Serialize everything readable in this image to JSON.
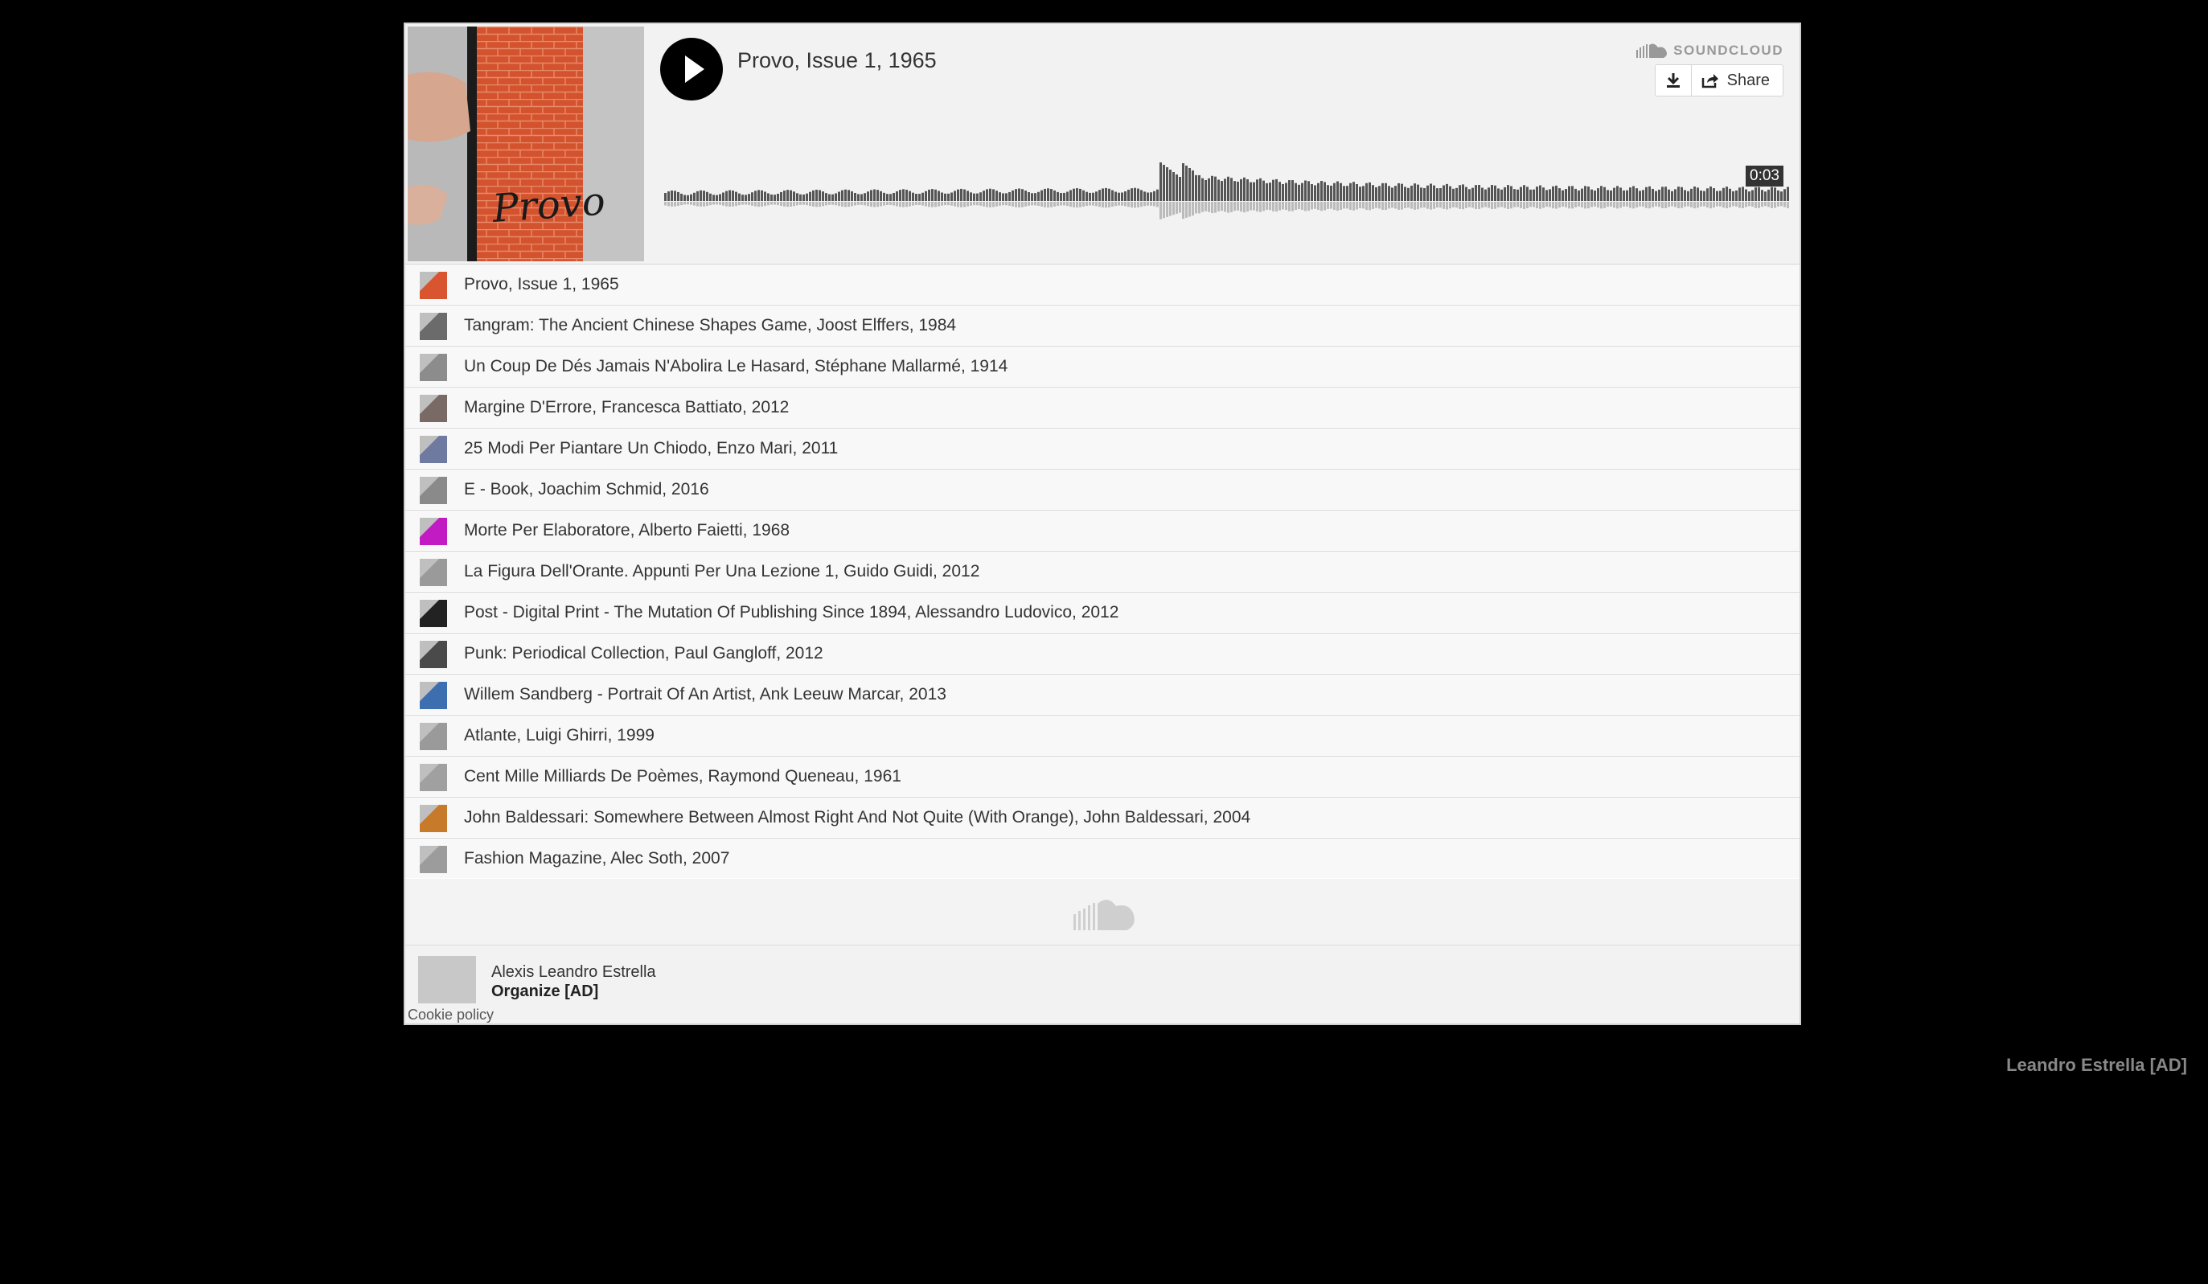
{
  "player": {
    "title": "Provo, Issue 1, 1965",
    "brand": "SOUNDCLOUD",
    "share_label": "Share",
    "time": "0:03",
    "artwork_text": "Provo"
  },
  "tracks": [
    {
      "title": "Provo, Issue 1, 1965",
      "color": "#d8552f"
    },
    {
      "title": "Tangram: The Ancient Chinese Shapes Game, Joost Elffers, 1984",
      "color": "#6b6b6b"
    },
    {
      "title": "Un Coup De Dés Jamais N'Abolira Le Hasard, Stéphane Mallarmé, 1914",
      "color": "#8c8c8c"
    },
    {
      "title": "Margine D'Errore, Francesca Battiato, 2012",
      "color": "#7a6a66"
    },
    {
      "title": "25 Modi Per Piantare Un Chiodo, Enzo Mari, 2011",
      "color": "#6f7aa0"
    },
    {
      "title": "E - Book, Joachim Schmid, 2016",
      "color": "#8a8a8a"
    },
    {
      "title": "Morte Per Elaboratore, Alberto Faietti, 1968",
      "color": "#c21bc4"
    },
    {
      "title": "La Figura Dell'Orante. Appunti Per Una Lezione 1, Guido Guidi, 2012",
      "color": "#9a9a9a"
    },
    {
      "title": "Post - Digital Print - The Mutation Of Publishing Since 1894, Alessandro Ludovico, 2012",
      "color": "#222222"
    },
    {
      "title": "Punk: Periodical Collection, Paul Gangloff, 2012",
      "color": "#4a4a4a"
    },
    {
      "title": "Willem Sandberg - Portrait Of An Artist, Ank Leeuw Marcar, 2013",
      "color": "#3d6fb0"
    },
    {
      "title": "Atlante, Luigi Ghirri, 1999",
      "color": "#9a9a9a"
    },
    {
      "title": "Cent Mille Milliards De Poèmes, Raymond Queneau, 1961",
      "color": "#a0a0a0"
    },
    {
      "title": "John Baldessari: Somewhere Between Almost Right And Not Quite (With Orange), John Baldessari, 2004",
      "color": "#c77a2a"
    },
    {
      "title": "Fashion Magazine, Alec Soth, 2007",
      "color": "#9c9c9c"
    }
  ],
  "footer": {
    "user": "Alexis Leandro Estrella",
    "set": "Organize [AD]",
    "cookie": "Cookie policy"
  },
  "page": {
    "author": "Leandro Estrella [AD]"
  },
  "colors": {
    "background": "#000000",
    "widget": "#f3f3f3",
    "waveform": "#555555",
    "waveform_reflection": "#bbbbbb"
  }
}
